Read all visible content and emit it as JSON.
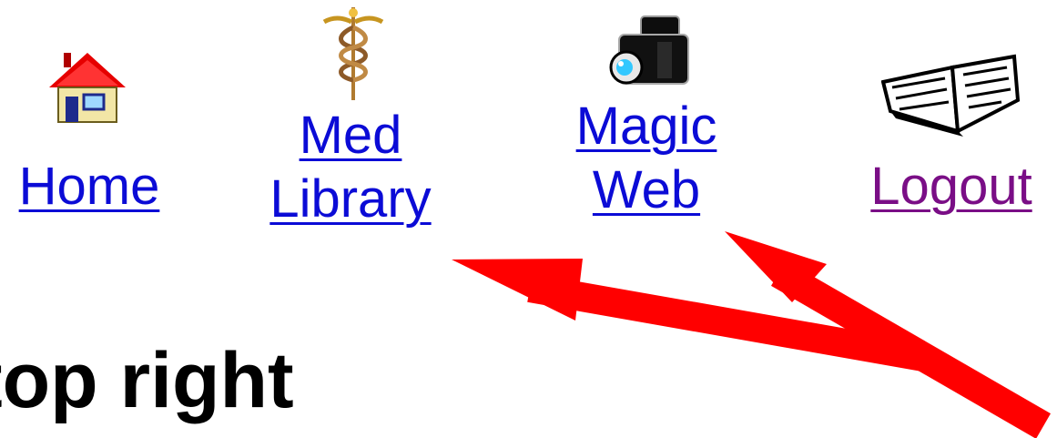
{
  "nav": {
    "items": [
      {
        "icon": "house-icon",
        "label_lines": [
          "Home"
        ]
      },
      {
        "icon": "caduceus-icon",
        "label_lines": [
          "Med",
          "Library"
        ]
      },
      {
        "icon": "camera-icon",
        "label_lines": [
          "Magic",
          "Web"
        ]
      },
      {
        "icon": "open-book-icon",
        "label_lines": [
          "Logout"
        ]
      }
    ]
  },
  "heading": {
    "text": "top right"
  },
  "colors": {
    "link": "#0b0bd6",
    "visited_link": "#7a0e86",
    "arrow": "#ff0000",
    "text": "#000000",
    "background": "#ffffff"
  }
}
